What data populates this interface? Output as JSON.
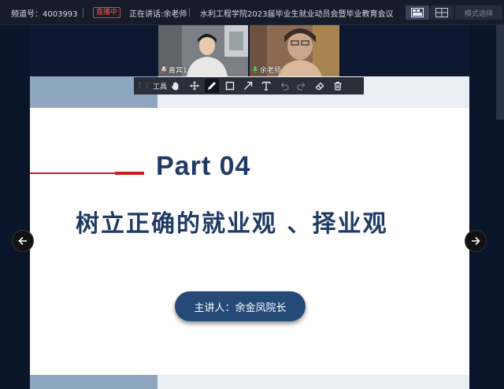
{
  "topbar": {
    "channel": "频道号：4003993",
    "live_badge": "直播中",
    "speaker": "正在讲话:余老师",
    "meeting_title": "水利工程学院2023届毕业生就业动员会暨毕业教育会议",
    "mode_select": "模式选择"
  },
  "videos": [
    {
      "name": "嘉宾1",
      "mic": "muted"
    },
    {
      "name": "余老师",
      "mic": "active"
    }
  ],
  "toolbar": {
    "label": "工具",
    "tools": [
      "hand-icon",
      "move-icon",
      "pen-icon",
      "rectangle-icon",
      "arrow-icon",
      "text-icon",
      "undo-icon",
      "redo-icon",
      "eraser-icon",
      "trash-icon"
    ],
    "selected": "pen-icon"
  },
  "slide": {
    "part": "Part 04",
    "title": "树立正确的就业观 、择业观",
    "presenter": "主讲人：余金凤院长"
  },
  "colors": {
    "accent_red": "#c81e1e",
    "slide_navy": "#1f3a64",
    "pill_blue": "#254a78",
    "live_red": "#e0463c"
  }
}
